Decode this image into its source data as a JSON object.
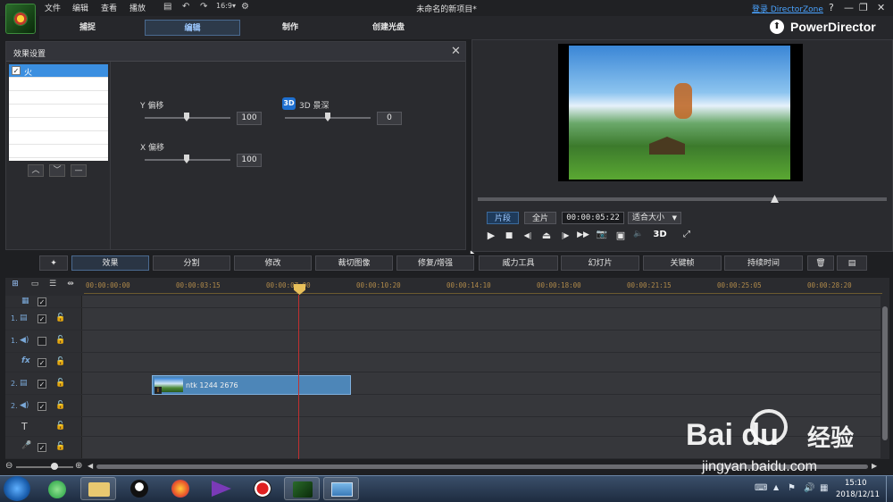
{
  "menubar": {
    "menus": [
      "文件",
      "编辑",
      "查看",
      "播放"
    ],
    "window_title": "未命名的新项目*",
    "login_link": "登录 DirectorZone",
    "help": "?",
    "minimize": "—",
    "restore": "❐",
    "close": "✕"
  },
  "modes": {
    "tabs": [
      "捕捉",
      "编辑",
      "制作",
      "创建光盘"
    ],
    "active": "编辑",
    "brand": "PowerDirector"
  },
  "effects": {
    "title": "效果设置",
    "close": "✕",
    "items": [
      {
        "label": "火",
        "checked": true
      }
    ],
    "list_buttons": [
      "︿",
      "﹀",
      "—"
    ],
    "params": {
      "y_label": "Y 偏移",
      "y_value": "100",
      "x_label": "X 偏移",
      "x_value": "100",
      "depth_badge": "3D",
      "depth_label": "3D 景深",
      "depth_value": "0"
    }
  },
  "preview": {
    "mode_clip": "片段",
    "mode_movie": "全片",
    "active_mode": "片段",
    "timecode": "00:00:05:22",
    "fit": "适合大小",
    "fit_arrow": "▼",
    "controls": [
      "▶",
      "■",
      "◀|",
      "⏏",
      "|▶",
      "▶▶",
      "📷",
      "▣",
      "🔈",
      "3D",
      "⤢"
    ]
  },
  "toolbar": {
    "buttons": [
      "效果",
      "分割",
      "修改",
      "裁切图像",
      "修复/增强",
      "威力工具",
      "幻灯片",
      "关键帧",
      "持续时间"
    ],
    "active": "效果"
  },
  "timeline": {
    "ticks": [
      "00:00:00:00",
      "00:00:03:15",
      "00:00:07:00",
      "00:00:10:20",
      "00:00:14:10",
      "00:00:18:00",
      "00:00:21:15",
      "00:00:25:05",
      "00:00:28:20"
    ],
    "tracks": [
      {
        "num": "",
        "icon": "▦",
        "checked": true,
        "lock": false
      },
      {
        "num": "1.",
        "icon": "▤",
        "checked": true,
        "lock": true
      },
      {
        "num": "1.",
        "icon": "◀)",
        "checked": false,
        "lock": true
      },
      {
        "num": "",
        "icon": "fx",
        "checked": true,
        "lock": true
      },
      {
        "num": "2.",
        "icon": "▤",
        "checked": true,
        "lock": true
      },
      {
        "num": "2.",
        "icon": "◀)",
        "checked": true,
        "lock": true
      },
      {
        "num": "",
        "icon": "T",
        "checked": null,
        "lock": true
      },
      {
        "num": "",
        "icon": "🎤",
        "checked": true,
        "lock": true
      }
    ],
    "clip_label": "ntk 1244 2676",
    "clip_info": "i"
  },
  "taskbar": {
    "time": "15:10",
    "date": "2018/12/11"
  },
  "watermark": {
    "brand": "Bai du",
    "chinese": "经验",
    "url": "jingyan.baidu.com"
  },
  "colors": {
    "accent": "#3b8fe0",
    "playhead": "#c03030",
    "clip": "#4d86b8",
    "link": "#4aa3ff"
  }
}
